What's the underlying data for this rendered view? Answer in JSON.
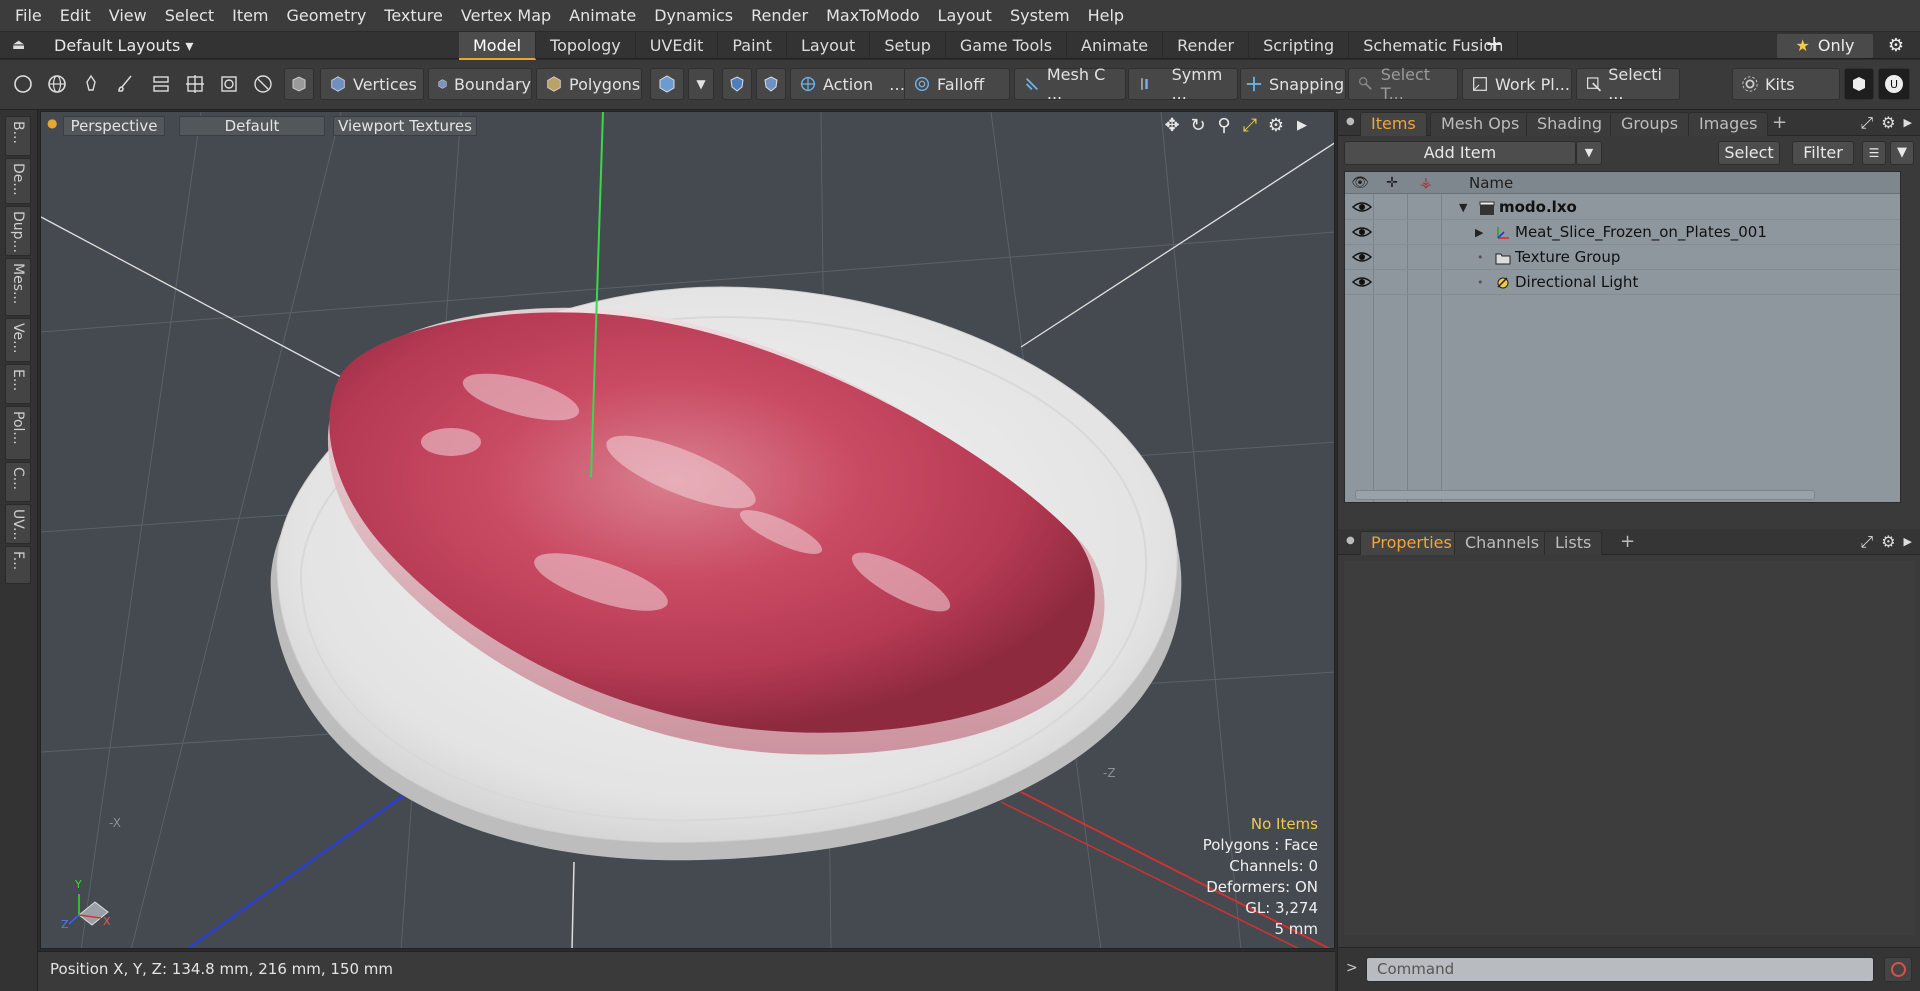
{
  "menu": [
    "File",
    "Edit",
    "View",
    "Select",
    "Item",
    "Geometry",
    "Texture",
    "Vertex Map",
    "Animate",
    "Dynamics",
    "Render",
    "MaxToModo",
    "Layout",
    "System",
    "Help"
  ],
  "layoutbar": {
    "default_layout": "Default Layouts ▾",
    "tabs": [
      "Model",
      "Topology",
      "UVEdit",
      "Paint",
      "Layout",
      "Setup",
      "Game Tools",
      "Animate",
      "Render",
      "Scripting",
      "Schematic Fusion"
    ],
    "active_tab": "Model",
    "only_label": "Only"
  },
  "toolbar": {
    "vertices": "Vertices",
    "boundary": "Boundary",
    "polygons": "Polygons",
    "action": "Action",
    "action_more": "…",
    "falloff": "Falloff",
    "mesh": "Mesh C ...",
    "symm": "Symm ...",
    "snapping": "Snapping",
    "select_t": "Select T...",
    "workpl": "Work Pl...",
    "selecti": "Selecti ...",
    "kits": "Kits"
  },
  "lefttabs": [
    "B...",
    "De...",
    "Dup...",
    "Mes...",
    "Ve...",
    "E...",
    "Pol...",
    "C...",
    "UV...",
    "F..."
  ],
  "viewport": {
    "perspective": "Perspective",
    "default": "Default",
    "textures": "Viewport Textures",
    "axis_labels": {
      "y": "Y",
      "x": "X",
      "z": "Z",
      "neg_x": "-X",
      "neg_z": "-Z"
    },
    "info": {
      "no_items": "No Items",
      "polygons": "Polygons : Face",
      "channels": "Channels: 0",
      "deformers": "Deformers: ON",
      "gl": "GL: 3,274",
      "scale": "5 mm"
    }
  },
  "status": {
    "position": "Position X, Y, Z:  134.8 mm, 216 mm, 150 mm"
  },
  "items_panel": {
    "tabs": [
      "Items",
      "Mesh Ops",
      "Shading",
      "Groups",
      "Images"
    ],
    "active": "Items",
    "add_item": "Add Item",
    "select": "Select",
    "filter": "Filter",
    "name_header": "Name",
    "rows": [
      {
        "label": "modo.lxo",
        "bold": true
      },
      {
        "label": "Meat_Slice_Frozen_on_Plates_001"
      },
      {
        "label": "Texture Group"
      },
      {
        "label": "Directional Light"
      }
    ]
  },
  "props_panel": {
    "tabs": [
      "Properties",
      "Channels",
      "Lists"
    ],
    "active": "Properties"
  },
  "command": {
    "placeholder": "Command"
  },
  "colors": {
    "accent": "#f0a63a",
    "viewport_bg": "#444a4f",
    "list_bg": "#8e979e"
  }
}
